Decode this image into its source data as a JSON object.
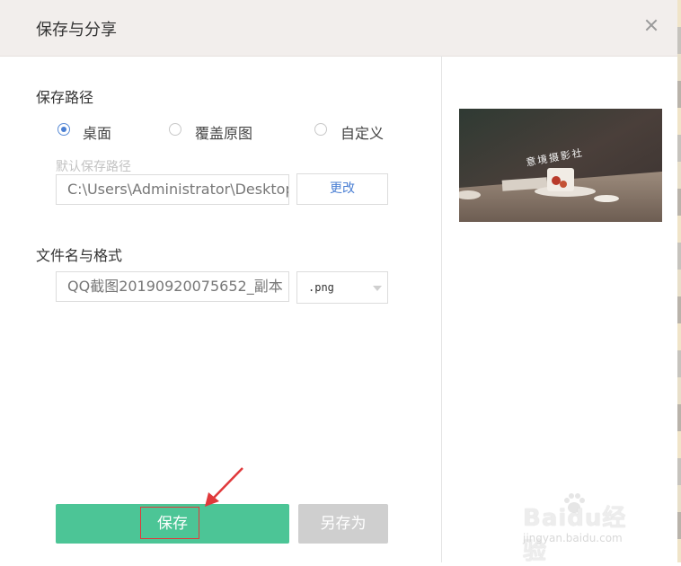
{
  "dialog": {
    "title": "保存与分享"
  },
  "save_path": {
    "heading": "保存路径",
    "options": [
      {
        "label": "桌面",
        "selected": true
      },
      {
        "label": "覆盖原图",
        "selected": false
      },
      {
        "label": "自定义",
        "selected": false
      }
    ],
    "default_hint": "默认保存路径",
    "path_value": "C:\\Users\\Administrator\\Desktop",
    "change_label": "更改"
  },
  "file": {
    "heading": "文件名与格式",
    "name_value": "QQ截图20190920075652_副本",
    "format_value": ".png"
  },
  "preview": {
    "overlay_text": "意境摄影社"
  },
  "actions": {
    "save_label": "保存",
    "save_as_label": "另存为"
  },
  "watermark": {
    "brand": "Baidu经验",
    "url": "jingyan.baidu.com"
  },
  "colors": {
    "accent_green": "#4cc596",
    "link_blue": "#4a7fd3",
    "annotation_red": "#e0393b"
  }
}
